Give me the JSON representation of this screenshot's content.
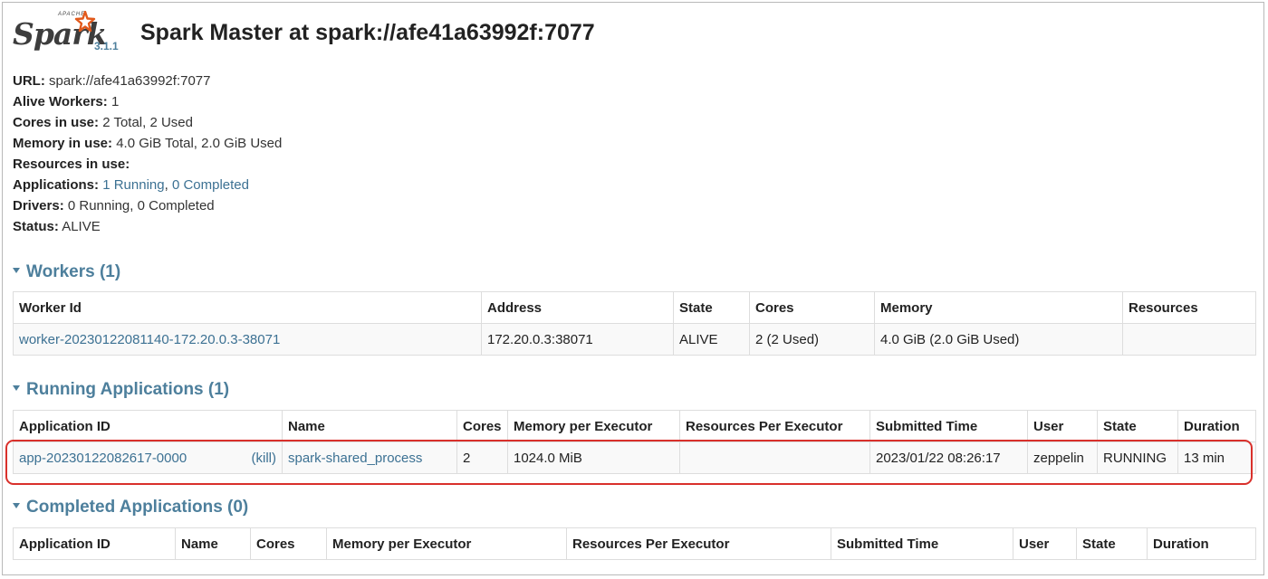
{
  "header": {
    "logo_apache": "APACHE",
    "logo_word": "Spark",
    "version": "3.1.1",
    "title": "Spark Master at spark://afe41a63992f:7077"
  },
  "summary": {
    "url_label": "URL:",
    "url_value": "spark://afe41a63992f:7077",
    "alive_workers_label": "Alive Workers:",
    "alive_workers_value": "1",
    "cores_label": "Cores in use:",
    "cores_value": "2 Total, 2 Used",
    "memory_label": "Memory in use:",
    "memory_value": "4.0 GiB Total, 2.0 GiB Used",
    "resources_label": "Resources in use:",
    "applications_label": "Applications:",
    "applications_running_count": "1",
    "applications_running_link": "Running",
    "applications_sep": ",",
    "applications_completed_count": "0",
    "applications_completed_link": "Completed",
    "drivers_label": "Drivers:",
    "drivers_value": "0 Running, 0 Completed",
    "status_label": "Status:",
    "status_value": "ALIVE"
  },
  "workers": {
    "title": "Workers (1)",
    "columns": [
      "Worker Id",
      "Address",
      "State",
      "Cores",
      "Memory",
      "Resources"
    ],
    "rows": [
      [
        "worker-20230122081140-172.20.0.3-38071",
        "172.20.0.3:38071",
        "ALIVE",
        "2 (2 Used)",
        "4.0 GiB (2.0 GiB Used)",
        ""
      ]
    ]
  },
  "running_apps": {
    "title": "Running Applications (1)",
    "columns": [
      "Application ID",
      "Name",
      "Cores",
      "Memory per Executor",
      "Resources Per Executor",
      "Submitted Time",
      "User",
      "State",
      "Duration"
    ],
    "kill_label": "(kill)",
    "rows": [
      [
        "app-20230122082617-0000",
        "spark-shared_process",
        "2",
        "1024.0 MiB",
        "",
        "2023/01/22 08:26:17",
        "zeppelin",
        "RUNNING",
        "13 min"
      ]
    ]
  },
  "completed_apps": {
    "title": "Completed Applications (0)",
    "columns": [
      "Application ID",
      "Name",
      "Cores",
      "Memory per Executor",
      "Resources Per Executor",
      "Submitted Time",
      "User",
      "State",
      "Duration"
    ]
  },
  "colors": {
    "link": "#3c7193",
    "section_header": "#4d7f9c",
    "highlight": "#d9302b",
    "row_background": "#f9f9f9"
  }
}
